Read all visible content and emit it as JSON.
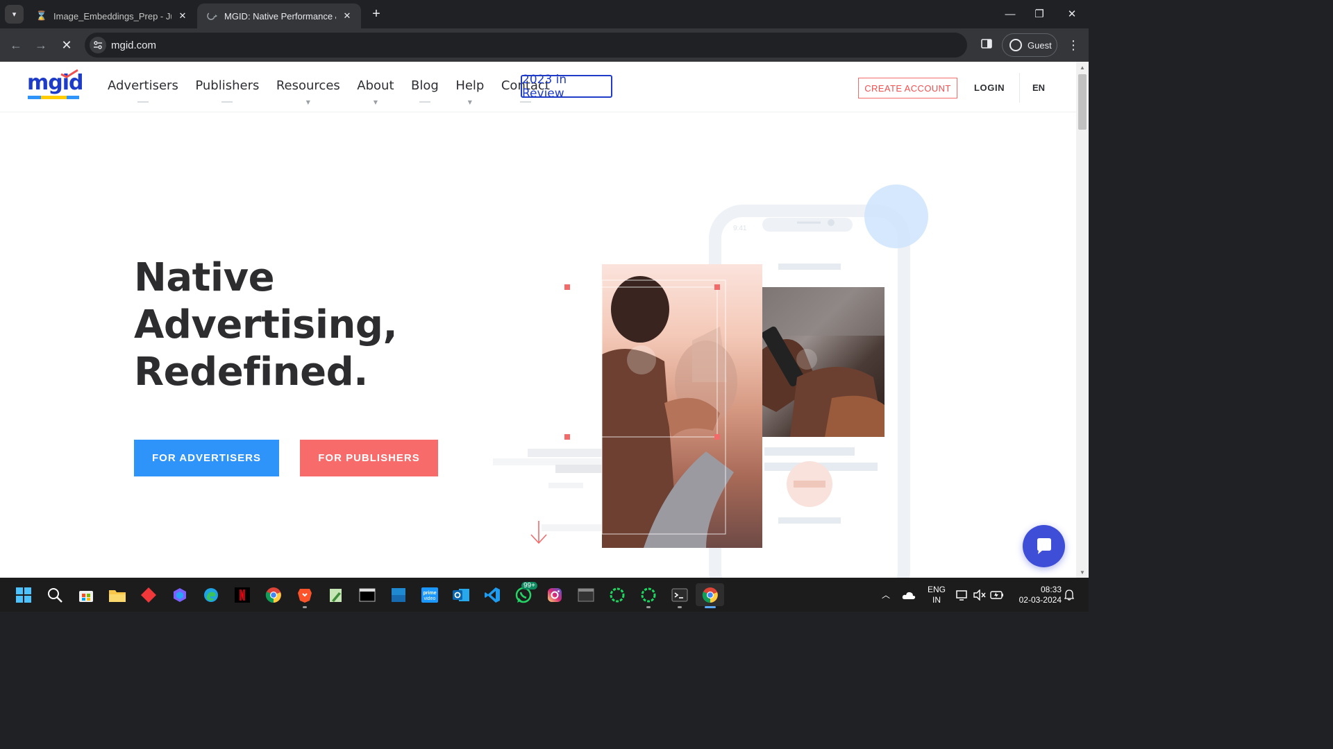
{
  "browser": {
    "tabs": [
      {
        "title": "Image_Embeddings_Prep - Jupyter",
        "active": false
      },
      {
        "title": "MGID: Native Performance & Programmatic",
        "active": true
      }
    ],
    "address": "mgid.com",
    "profile_label": "Guest",
    "loading": true
  },
  "site": {
    "logo_text": "mgid",
    "logo_colors": [
      "#1e3cc8",
      "#2e94fa",
      "#ffcc00",
      "#f04f4f"
    ],
    "nav": [
      {
        "label": "Advertisers",
        "has_dropdown": false
      },
      {
        "label": "Publishers",
        "has_dropdown": false
      },
      {
        "label": "Resources",
        "has_dropdown": true
      },
      {
        "label": "About",
        "has_dropdown": true
      },
      {
        "label": "Blog",
        "has_dropdown": false
      },
      {
        "label": "Help",
        "has_dropdown": true
      },
      {
        "label": "Contact",
        "has_dropdown": false
      }
    ],
    "nav_highlight": "2023 in Review",
    "create_account": "CREATE ACCOUNT",
    "login": "LOGIN",
    "language": "EN"
  },
  "hero": {
    "title_lines": [
      "Native",
      "Advertising,",
      "Redefined."
    ],
    "cta_advertisers": "FOR ADVERTISERS",
    "cta_publishers": "FOR PUBLISHERS",
    "phone_time": "9:41"
  },
  "colors": {
    "accent_blue": "#2e94fa",
    "accent_red": "#f76b6b",
    "brand_dark_blue": "#1e3cc8",
    "chat_button": "#3f4ed6"
  },
  "taskbar": {
    "apps": [
      "start-icon",
      "search-icon",
      "store-icon",
      "file-explorer-icon",
      "git-icon",
      "copilot-icon",
      "edge-icon",
      "netflix-icon",
      "chrome-icon",
      "brave-icon",
      "notepad-icon",
      "terminal-icon",
      "word-icon",
      "prime-video-icon",
      "outlook-icon",
      "vscode-icon",
      "whatsapp-icon",
      "instagram-icon",
      "cmd-icon",
      "spinner-icon",
      "spinner-icon",
      "terminal-icon",
      "chrome-icon"
    ],
    "whatsapp_badge": "99+",
    "tray_lang_line1": "ENG",
    "tray_lang_line2": "IN",
    "time": "08:33",
    "date": "02-03-2024"
  }
}
